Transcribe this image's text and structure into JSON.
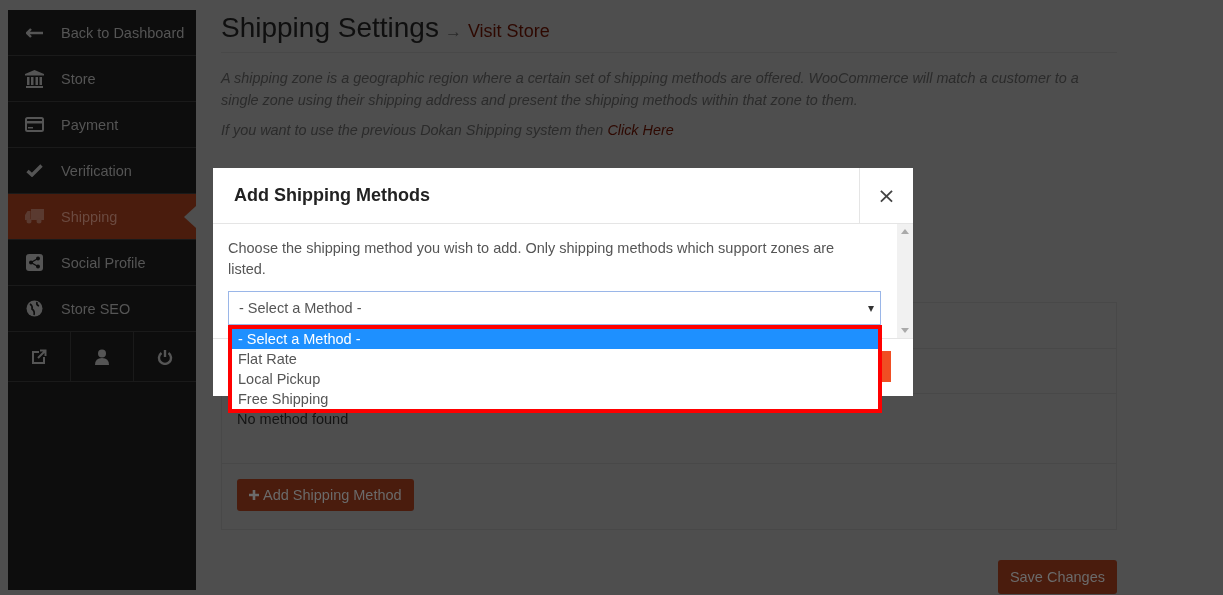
{
  "sidebar": {
    "items": [
      {
        "kind": "back",
        "label": "Back to Dashboard",
        "selected": false
      },
      {
        "kind": "store",
        "label": "Store",
        "selected": false
      },
      {
        "kind": "payment",
        "label": "Payment",
        "selected": false
      },
      {
        "kind": "verification",
        "label": "Verification",
        "selected": false
      },
      {
        "kind": "shipping",
        "label": "Shipping",
        "selected": true
      },
      {
        "kind": "social",
        "label": "Social Profile",
        "selected": false
      },
      {
        "kind": "seo",
        "label": "Store SEO",
        "selected": false
      }
    ],
    "bottom_buttons": [
      {
        "kind": "external-link"
      },
      {
        "kind": "user"
      },
      {
        "kind": "power"
      }
    ]
  },
  "page": {
    "title": "Shipping Settings",
    "arrow": "→",
    "visit_link": "Visit Store",
    "description": "A shipping zone is a geographic region where a certain set of shipping methods are offered. WooCommerce will match a customer to a single zone using their shipping address and present the shipping methods within that zone to them.",
    "legacy_note": "If you want to use the previous Dokan Shipping system then",
    "legacy_link": "Click Here",
    "empty_message": "No method found",
    "add_button": "Add Shipping Method",
    "save_button": "Save Changes"
  },
  "modal": {
    "title": "Add Shipping Methods",
    "close": "×",
    "instruction": "Choose the shipping method you wish to add. Only shipping methods which support zones are listed.",
    "select_value": "- Select a Method -",
    "select_caret": "▾",
    "options": [
      {
        "label": "- Select a Method -",
        "selected": true
      },
      {
        "label": "Flat Rate",
        "selected": false
      },
      {
        "label": "Local Pickup",
        "selected": false
      },
      {
        "label": "Free Shipping",
        "selected": false
      }
    ]
  }
}
